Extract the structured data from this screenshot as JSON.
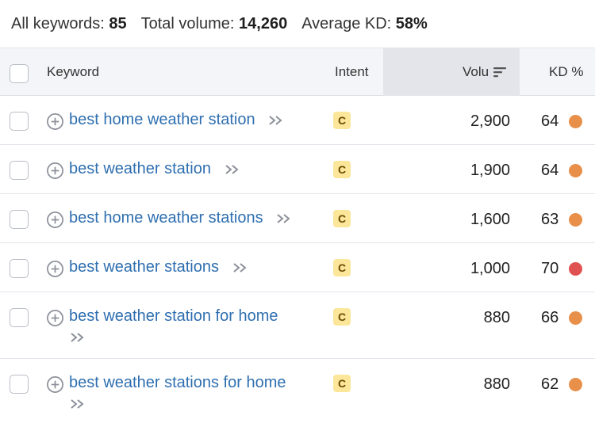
{
  "summary": {
    "all_keywords_label": "All keywords:",
    "all_keywords_value": "85",
    "total_volume_label": "Total volume:",
    "total_volume_value": "14,260",
    "average_kd_label": "Average KD:",
    "average_kd_value": "58%"
  },
  "table": {
    "columns": {
      "keyword": "Keyword",
      "intent": "Intent",
      "volume": "Volu",
      "kd": "KD %"
    },
    "rows": [
      {
        "keyword": "best home weather station",
        "intent": "C",
        "volume": "2,900",
        "kd": "64",
        "kd_color": "#e8904a"
      },
      {
        "keyword": "best weather station",
        "intent": "C",
        "volume": "1,900",
        "kd": "64",
        "kd_color": "#e8904a"
      },
      {
        "keyword": "best home weather stations",
        "intent": "C",
        "volume": "1,600",
        "kd": "63",
        "kd_color": "#e8904a"
      },
      {
        "keyword": "best weather stations",
        "intent": "C",
        "volume": "1,000",
        "kd": "70",
        "kd_color": "#e05252"
      },
      {
        "keyword": "best weather station for home",
        "intent": "C",
        "volume": "880",
        "kd": "66",
        "kd_color": "#e8904a"
      },
      {
        "keyword": "best weather stations for home",
        "intent": "C",
        "volume": "880",
        "kd": "62",
        "kd_color": "#e8904a"
      }
    ]
  },
  "colors": {
    "keyword_link": "#2f6fb0",
    "intent_badge_bg": "#fbe69a",
    "intent_badge_text": "#6a4a00"
  },
  "icons": {
    "add": "plus-circle-icon",
    "open": "double-chevron-right-icon",
    "sort": "sort-descending-icon"
  }
}
